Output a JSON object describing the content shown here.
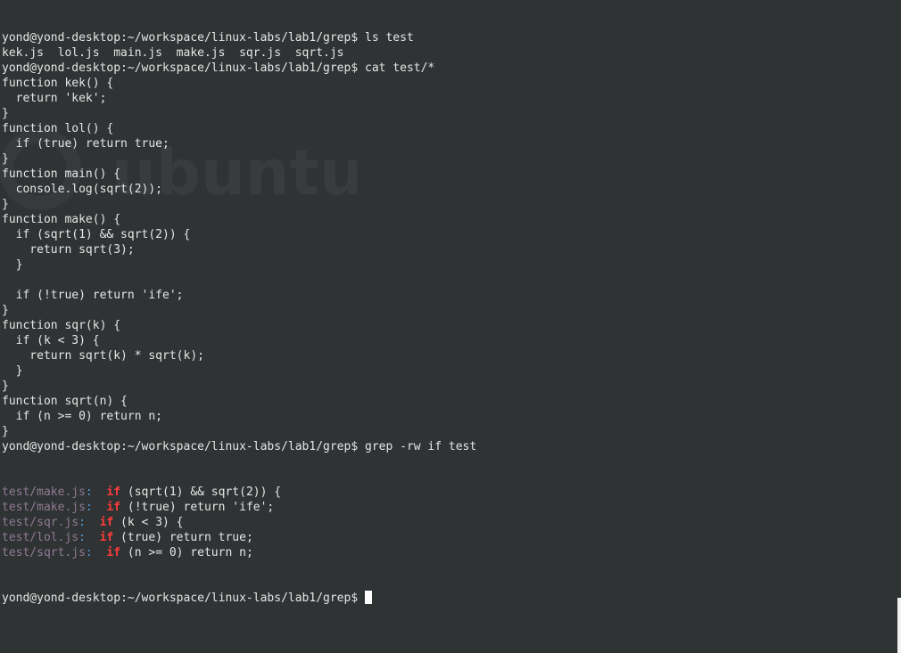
{
  "terminal": {
    "colors": {
      "background": "#2f3334",
      "text": "#e6e6e6",
      "grep_filename": "#8f7a94",
      "grep_match": "#ff3b3b",
      "cursor": "#ffffff"
    },
    "watermark_text": "ubuntu",
    "lines": [
      "yond@yond-desktop:~/workspace/linux-labs/lab1/grep$ ls test",
      "kek.js  lol.js  main.js  make.js  sqr.js  sqrt.js",
      "yond@yond-desktop:~/workspace/linux-labs/lab1/grep$ cat test/*",
      "function kek() {",
      "  return 'kek';",
      "}",
      "function lol() {",
      "  if (true) return true;",
      "}",
      "function main() {",
      "  console.log(sqrt(2));",
      "}",
      "function make() {",
      "  if (sqrt(1) && sqrt(2)) {",
      "    return sqrt(3);",
      "  }",
      "",
      "  if (!true) return 'ife';",
      "}",
      "function sqr(k) {",
      "  if (k < 3) {",
      "    return sqrt(k) * sqrt(k);",
      "  }",
      "}",
      "function sqrt(n) {",
      "  if (n >= 0) return n;",
      "}",
      "yond@yond-desktop:~/workspace/linux-labs/lab1/grep$ grep -rw if test"
    ],
    "grep_results": [
      {
        "file": "test/make.js",
        "sep": ":",
        "pad": "  ",
        "match": "if",
        "rest": " (sqrt(1) && sqrt(2)) {"
      },
      {
        "file": "test/make.js",
        "sep": ":",
        "pad": "  ",
        "match": "if",
        "rest": " (!true) return 'ife';"
      },
      {
        "file": "test/sqr.js",
        "sep": ":",
        "pad": "  ",
        "match": "if",
        "rest": " (k < 3) {"
      },
      {
        "file": "test/lol.js",
        "sep": ":",
        "pad": "  ",
        "match": "if",
        "rest": " (true) return true;"
      },
      {
        "file": "test/sqrt.js",
        "sep": ":",
        "pad": "  ",
        "match": "if",
        "rest": " (n >= 0) return n;"
      }
    ],
    "prompt": "yond@yond-desktop:~/workspace/linux-labs/lab1/grep$ "
  }
}
